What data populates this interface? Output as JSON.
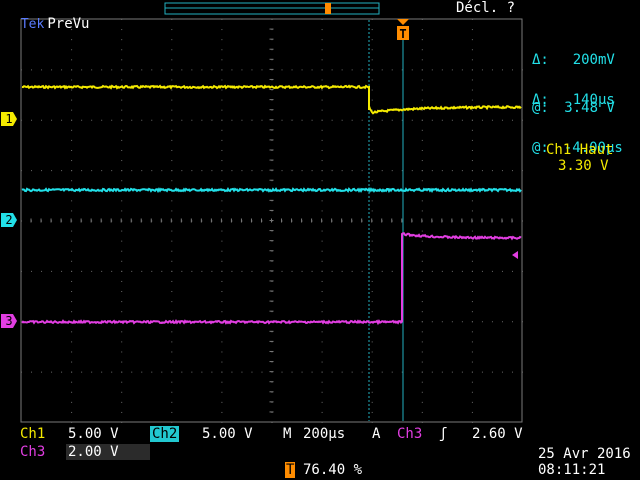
{
  "header": {
    "brand": "Tek",
    "mode": "PreVu",
    "trigger_status": "Décl. ?"
  },
  "cursors": {
    "voltage_delta_symbol": "Δ:",
    "voltage_delta": "200mV",
    "voltage_at_symbol": "@:",
    "voltage_at": "3.48 V",
    "time_delta_symbol": "Δ:",
    "time_delta": "140μs",
    "time_at_symbol": "@:",
    "time_at": "-4.00μs"
  },
  "measurement": {
    "label": "Ch1 Haut",
    "value": "3.30 V"
  },
  "channels": {
    "ch1": {
      "marker": "1",
      "label": "Ch1",
      "scale": "5.00 V",
      "color": "#f4ea00"
    },
    "ch2": {
      "marker": "2",
      "label": "Ch2",
      "scale": "5.00 V",
      "color": "#22e0e8"
    },
    "ch3": {
      "marker": "3",
      "label": "Ch3",
      "scale": "2.00 V",
      "color": "#e23ee2"
    }
  },
  "timebase": {
    "label": "M",
    "value": "200μs"
  },
  "trigger": {
    "label": "A",
    "source": "Ch3",
    "slope_icon": "rising-edge-icon",
    "slope_glyph": "ʃ",
    "level": "2.60 V",
    "marker": "T",
    "position": "76.40 %"
  },
  "datetime": {
    "date": "25 Avr  2016",
    "time": "08:11:21"
  }
}
